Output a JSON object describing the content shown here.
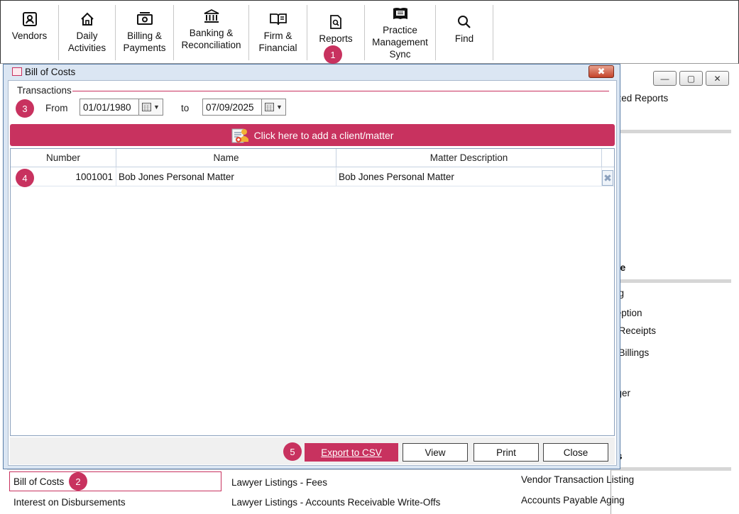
{
  "toolbar": {
    "buttons": [
      {
        "label": "Vendors",
        "icon": "vendor-icon"
      },
      {
        "label": "Daily\nActivities",
        "icon": "home-icon"
      },
      {
        "label": "Billing &\nPayments",
        "icon": "money-icon"
      },
      {
        "label": "Banking &\nReconciliation",
        "icon": "bank-icon"
      },
      {
        "label": "Firm &\nFinancial",
        "icon": "book-icon"
      },
      {
        "label": "Reports",
        "icon": "report-search-icon"
      },
      {
        "label": "Practice\nManagement\nSync",
        "icon": "dye-durham-icon"
      },
      {
        "label": "Find",
        "icon": "search-icon"
      }
    ]
  },
  "callouts": [
    "1",
    "2",
    "3",
    "4",
    "5"
  ],
  "dialog": {
    "title": "Bill of Costs",
    "section": "Transactions",
    "from_label": "From",
    "from_value": "01/01/1980",
    "to_label": "to",
    "to_value": "07/09/2025",
    "add_client_label": "Click here to add a client/matter",
    "grid": {
      "headers": [
        "Number",
        "Name",
        "Matter Description"
      ],
      "rows": [
        {
          "number": "1001001",
          "name": "Bob Jones Personal Matter",
          "description": "Bob Jones Personal Matter"
        }
      ]
    },
    "buttons": {
      "export": "Export to CSV",
      "view": "View",
      "print": "Print",
      "close": "Close"
    }
  },
  "background_window": {
    "items": [
      "rized Reports",
      "ing",
      "ception",
      "y Receipts",
      "y Billings",
      "dger"
    ],
    "headings": [
      "ble",
      "es"
    ]
  },
  "report_list": {
    "col1": [
      "Bill of Costs",
      "Interest on Disbursements"
    ],
    "col2": [
      "Lawyer Listings - Fees",
      "Lawyer Listings - Accounts Receivable Write-Offs"
    ],
    "col3": [
      "Vendor Transaction Listing",
      "Accounts Payable Aging"
    ]
  },
  "colors": {
    "accent": "#c8325f",
    "dialog_bg": "#dbe6f3"
  }
}
